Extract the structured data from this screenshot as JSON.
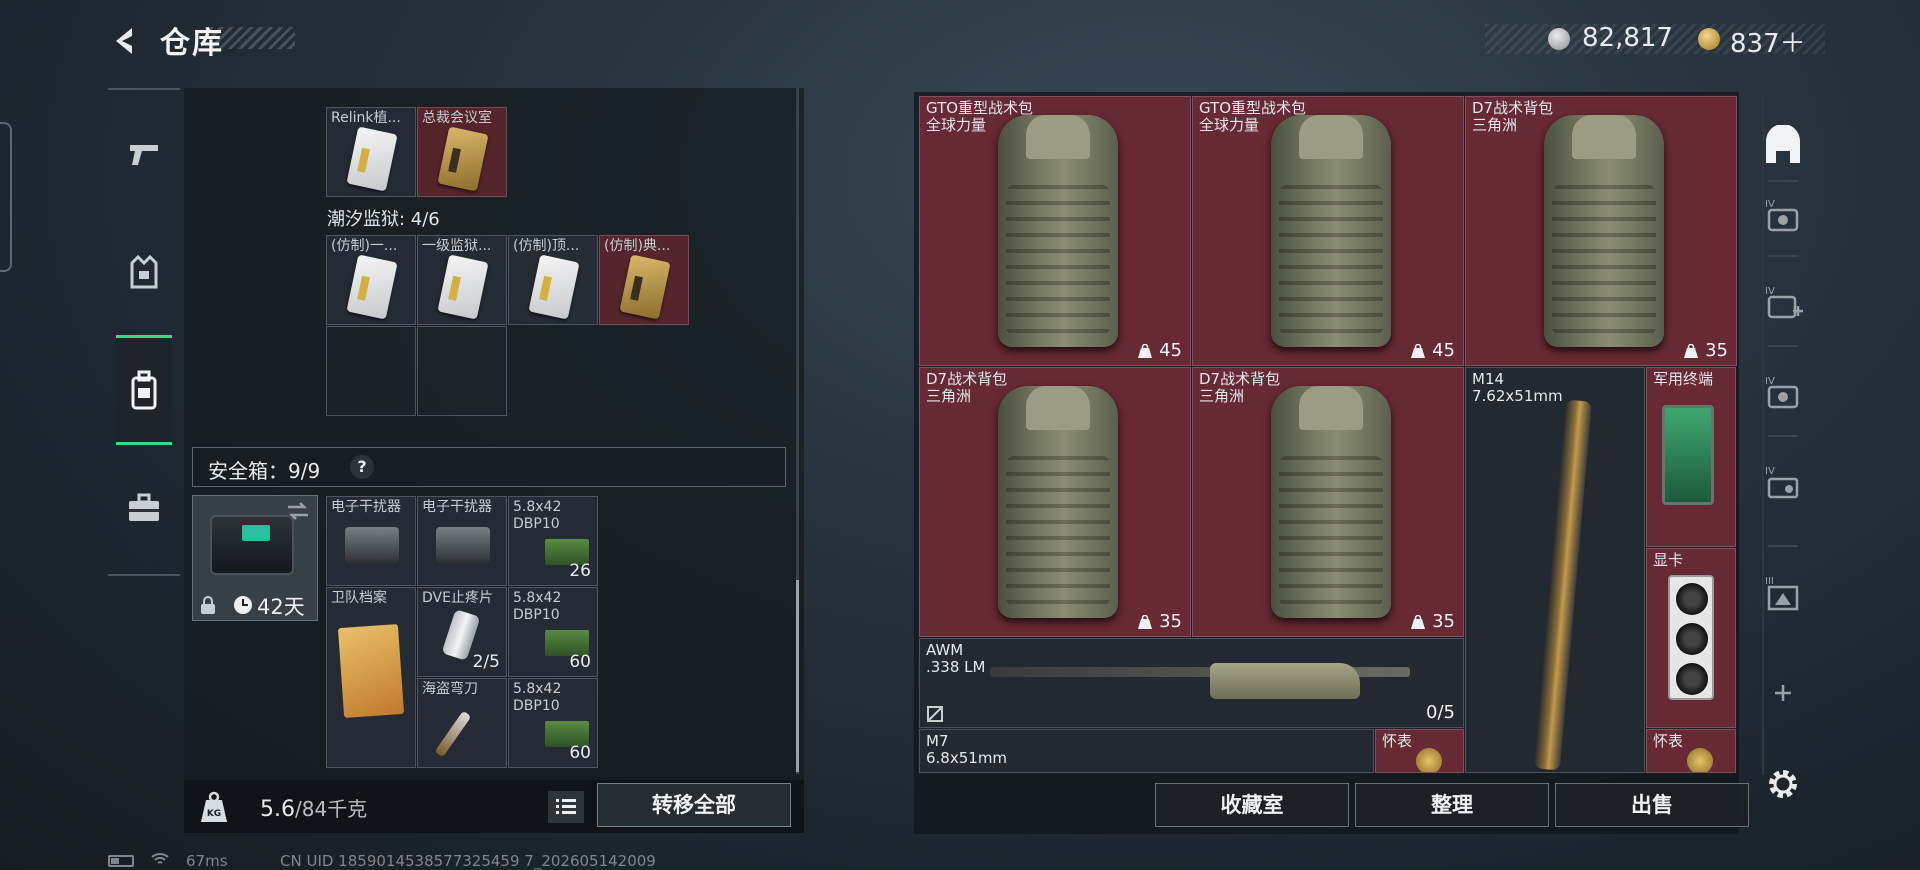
{
  "header": {
    "title": "仓库",
    "currency_silver": "82,817",
    "currency_gold": "837＋"
  },
  "left_tabs": [
    {
      "name": "weapons"
    },
    {
      "name": "equipment"
    },
    {
      "name": "backpack",
      "active": true
    },
    {
      "name": "briefcase"
    }
  ],
  "storage": {
    "top_items": [
      {
        "label": "Relink植...",
        "color": "dark"
      },
      {
        "label": "总裁会议室",
        "color": "red"
      }
    ],
    "section_tide_prison": "潮汐监狱: 4/6",
    "tide_items": [
      {
        "label": "(仿制)一...",
        "color": "dark"
      },
      {
        "label": "一级监狱...",
        "color": "dark"
      },
      {
        "label": "(仿制)顶...",
        "color": "dark"
      },
      {
        "label": "(仿制)典...",
        "color": "red"
      }
    ]
  },
  "safe_box": {
    "label": "安全箱：9/9",
    "help": "?",
    "days": "42天",
    "items": [
      {
        "label": "电子干扰器",
        "count": ""
      },
      {
        "label": "电子干扰器",
        "count": ""
      },
      {
        "label": "5.8x42 DBP10",
        "count": "26"
      },
      {
        "label": "卫队档案",
        "count": ""
      },
      {
        "label": "DVE止疼片",
        "count": "2/5"
      },
      {
        "label": "5.8x42 DBP10",
        "count": "60"
      },
      {
        "label": "海盗弯刀",
        "count": ""
      },
      {
        "label": "5.8x42 DBP10",
        "count": "60"
      }
    ]
  },
  "weight": {
    "current": "5.6",
    "max": "/84千克"
  },
  "buttons": {
    "transfer_all": "转移全部",
    "collection": "收藏室",
    "organize": "整理",
    "sell": "出售"
  },
  "right_grid": {
    "backpacks": [
      {
        "name": "GTO重型战术包",
        "maker": "全球力量",
        "count": "45"
      },
      {
        "name": "GTO重型战术包",
        "maker": "全球力量",
        "count": "45"
      },
      {
        "name": "D7战术背包",
        "maker": "三角洲",
        "count": "35"
      },
      {
        "name": "D7战术背包",
        "maker": "三角洲",
        "count": "35"
      },
      {
        "name": "D7战术背包",
        "maker": "三角洲",
        "count": "35"
      }
    ],
    "m14": {
      "name": "M14",
      "caliber": "7.62x51mm"
    },
    "terminal": "军用终端",
    "gpu": "显卡",
    "awm": {
      "name": "AWM",
      "caliber": ".338 LM",
      "count": "0/5"
    },
    "m7": {
      "name": "M7",
      "caliber": "6.8x51mm"
    },
    "watch1": "怀表",
    "watch2": "怀表"
  },
  "status_bar": {
    "ping": "67ms",
    "uid": "CN UID 1859014538577325459 7_202605142009"
  }
}
